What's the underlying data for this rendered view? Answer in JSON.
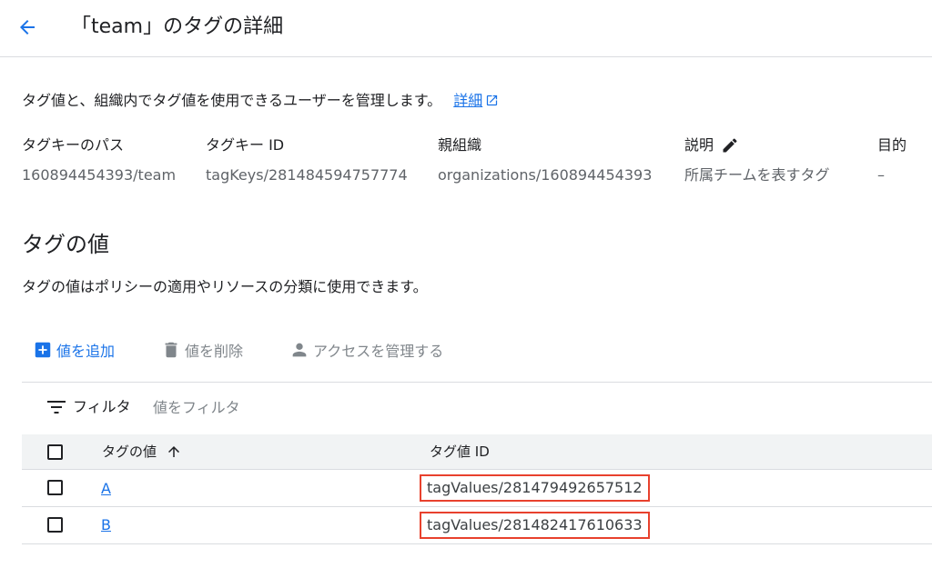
{
  "header": {
    "title": "「team」のタグの詳細"
  },
  "intro": {
    "text": "タグ値と、組織内でタグ値を使用できるユーザーを管理します。",
    "link_label": "詳細"
  },
  "metadata": [
    {
      "label": "タグキーのパス",
      "value": "160894454393/team"
    },
    {
      "label": "タグキー ID",
      "value": "tagKeys/281484594757774"
    },
    {
      "label": "親組織",
      "value": "organizations/160894454393"
    },
    {
      "label": "説明",
      "value": "所属チームを表すタグ",
      "icon": "edit-icon"
    },
    {
      "label": "目的",
      "value": "–"
    }
  ],
  "section": {
    "title": "タグの値",
    "description": "タグの値はポリシーの適用やリソースの分類に使用できます。"
  },
  "toolbar": {
    "add_label": "値を追加",
    "delete_label": "値を削除",
    "access_label": "アクセスを管理する"
  },
  "filter": {
    "label": "フィルタ",
    "placeholder": "値をフィルタ"
  },
  "table": {
    "columns": [
      "タグの値",
      "タグ値 ID"
    ],
    "rows": [
      {
        "value": "A",
        "id": "tagValues/281479492657512"
      },
      {
        "value": "B",
        "id": "tagValues/281482417610633"
      }
    ]
  },
  "colors": {
    "accent": "#1a73e8",
    "highlight": "#e8412d",
    "muted": "#5f6368"
  }
}
